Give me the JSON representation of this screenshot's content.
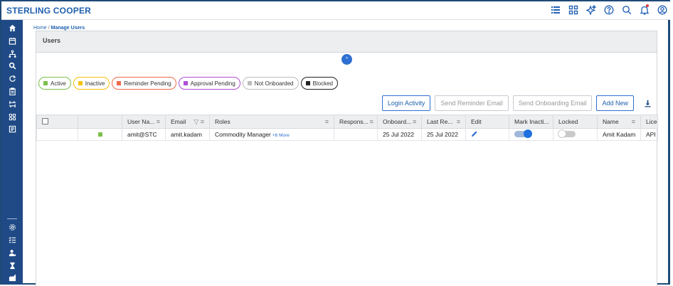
{
  "app": {
    "brand": "STERLING COOPER"
  },
  "topbar": {
    "icons": [
      "list-icon",
      "grid-icon",
      "sparkle-icon",
      "help-icon",
      "search-icon",
      "bell-icon",
      "user-icon"
    ]
  },
  "breadcrumb": {
    "home": "Home",
    "separator": "/",
    "current": "Manage Users"
  },
  "panel": {
    "title": "Users",
    "collapse_glyph": "^"
  },
  "filters": [
    {
      "label": "Active",
      "color": "#7cc04b",
      "border": "#7cc04b"
    },
    {
      "label": "Inactive",
      "color": "#f4c20d",
      "border": "#f4c20d"
    },
    {
      "label": "Reminder Pending",
      "color": "#ee6a4a",
      "border": "#ee6a4a"
    },
    {
      "label": "Approval Pending",
      "color": "#b04fd6",
      "border": "#b04fd6"
    },
    {
      "label": "Not Onboarded",
      "color": "#bdbdbd",
      "border": "#bdbdbd"
    },
    {
      "label": "Blocked",
      "color": "#222222",
      "border": "#222222"
    }
  ],
  "actions": {
    "login_activity": "Login Activity",
    "send_reminder": "Send Reminder Email",
    "send_onboarding": "Send Onboarding Email",
    "add_new": "Add New"
  },
  "table": {
    "headers": {
      "username": "User Na...",
      "email": "Email",
      "roles": "Roles",
      "responsibility": "Respons...",
      "onboarded": "Onboard...",
      "last_reminder": "Last Re...",
      "edit": "Edit",
      "mark_inactive": "Mark Inacti...",
      "locked": "Locked",
      "name": "Name",
      "license": "Lice"
    },
    "rows": [
      {
        "status_color": "#7cc04b",
        "username": "amit@STC",
        "email": "amit.kadam",
        "role": "Commodity Manager",
        "more_roles": "+6 More",
        "responsibility": "",
        "onboarded": "25 Jul 2022",
        "last_reminder": "25 Jul 2022",
        "mark_inactive": true,
        "locked": false,
        "name": "Amit Kadam",
        "license": "API"
      }
    ]
  },
  "colors": {
    "accent": "#1f5fae",
    "sidebar": "#1f4a86"
  }
}
